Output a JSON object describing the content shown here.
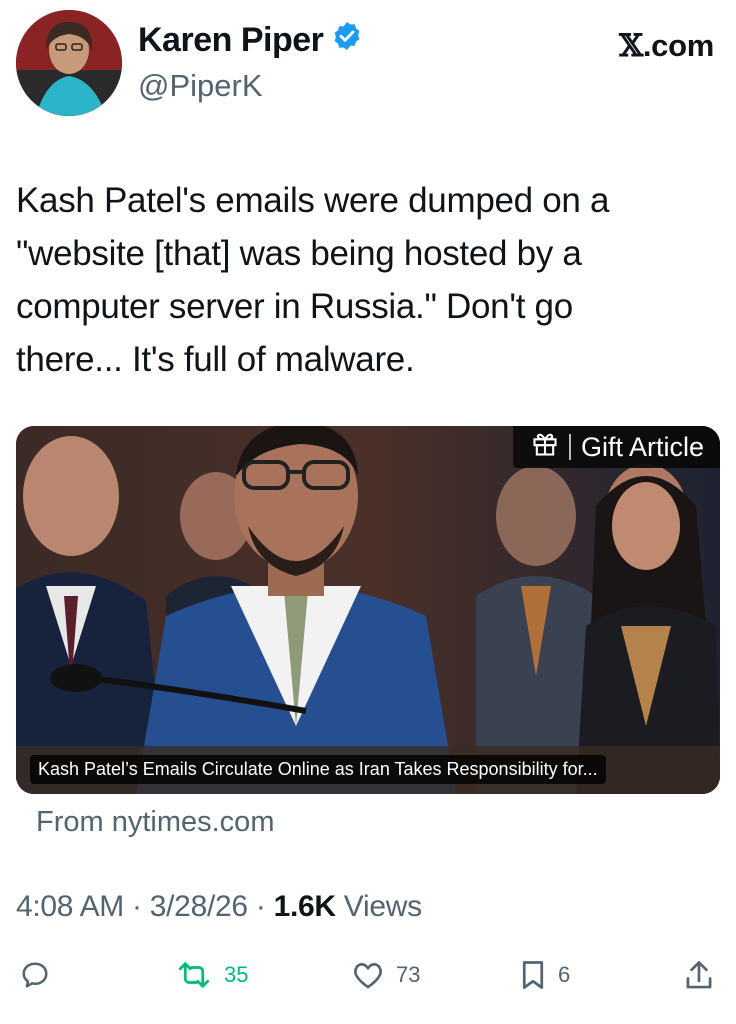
{
  "author": {
    "name": "Karen Piper",
    "handle": "@PiperK",
    "verified": true,
    "avatar_icon": "profile-photo"
  },
  "site_label": "X.com",
  "tweet": {
    "text": "Kash Patel's emails were dumped on a\n\"website [that] was being hosted by a\ncomputer server in Russia.\" Don't go\nthere... It's full of malware."
  },
  "card": {
    "gift_label": "Gift Article",
    "gift_icon": "gift-icon",
    "headline": "Kash Patel’s Emails Circulate Online as Iran Takes Responsibility for...",
    "source": "From nytimes.com"
  },
  "meta": {
    "time": "4:08 AM",
    "date": "3/28/26",
    "views_count": "1.6K",
    "views_label": "Views",
    "separator": "·"
  },
  "actions": {
    "reply_count": "",
    "retweet_count": "35",
    "like_count": "73",
    "bookmark_count": "6"
  },
  "colors": {
    "retweet_green": "#00ba7c",
    "muted": "#536471",
    "verified_blue": "#1d9bf0"
  }
}
